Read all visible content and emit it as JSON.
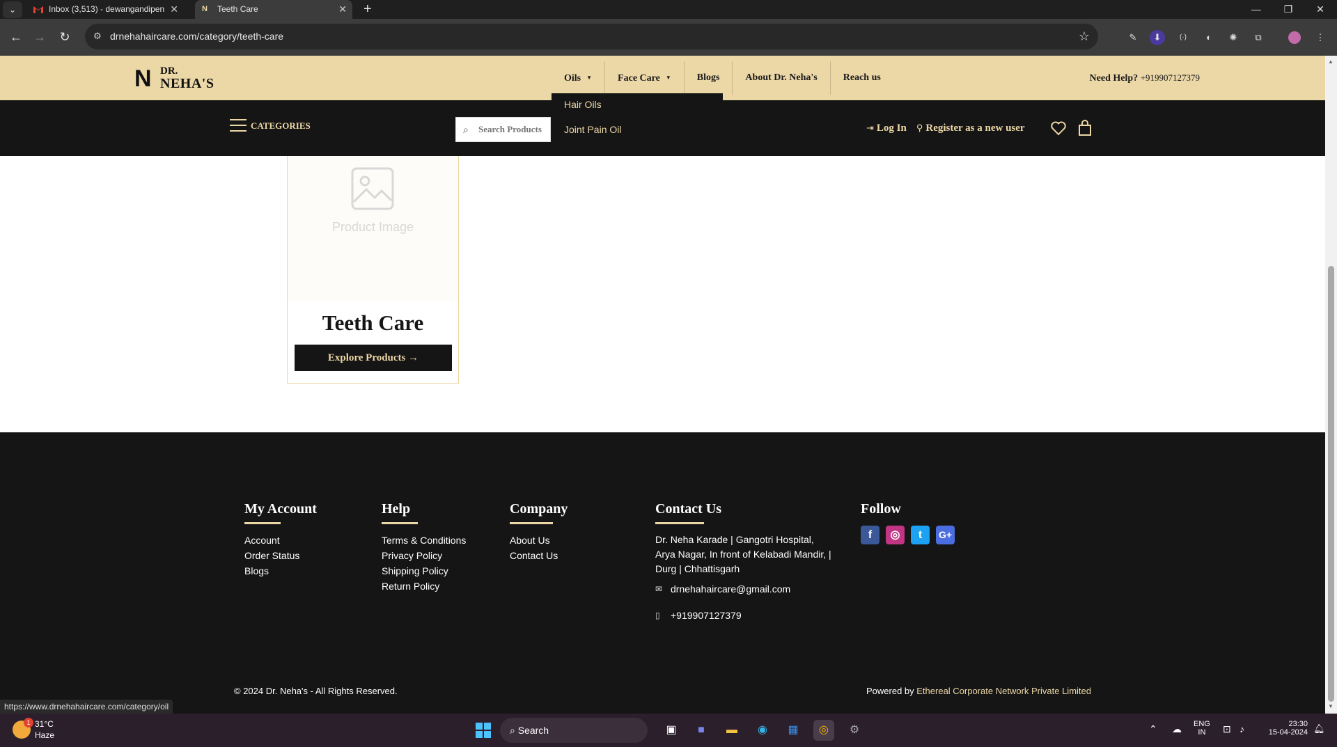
{
  "browser": {
    "tabs": [
      {
        "label": "Inbox (3,513) - dewangandipen",
        "active": false
      },
      {
        "label": "Teeth Care",
        "active": true
      }
    ],
    "url": "drnehahaircare.com/category/teeth-care",
    "status_url": "https://www.drnehahaircare.com/category/oil"
  },
  "site": {
    "logo": {
      "top": "DR.",
      "bottom": "NEHA'S"
    },
    "menu": [
      {
        "label": "Oils",
        "has_caret": true
      },
      {
        "label": "Face Care",
        "has_caret": true
      },
      {
        "label": "Blogs"
      },
      {
        "label": "About Dr. Neha's"
      },
      {
        "label": "Reach us"
      }
    ],
    "help": {
      "label": "Need Help?",
      "phone": "+919907127379"
    },
    "categories_label": "CATEGORIES",
    "search_placeholder": "Search Products",
    "oils_dropdown": [
      "Hair Oils",
      "Joint Pain Oil"
    ],
    "account": {
      "login": "Log In",
      "register": "Register as a new user"
    }
  },
  "card": {
    "placeholder": "Product Image",
    "title": "Teeth Care",
    "button": "Explore Products"
  },
  "footer": {
    "my_account": {
      "heading": "My Account",
      "links": [
        "Account",
        "Order Status",
        "Blogs"
      ]
    },
    "help": {
      "heading": "Help",
      "links": [
        "Terms & Conditions",
        "Privacy Policy",
        "Shipping Policy",
        "Return Policy"
      ]
    },
    "company": {
      "heading": "Company",
      "links": [
        "About Us",
        "Contact Us"
      ]
    },
    "contact": {
      "heading": "Contact Us",
      "address_lines": [
        "Dr. Neha Karade | Gangotri Hospital,",
        "Arya Nagar, In front of Kelabadi Mandir, |",
        "Durg | Chhattisgarh"
      ],
      "email": "drnehahaircare@gmail.com",
      "phone": "+919907127379"
    },
    "follow": {
      "heading": "Follow",
      "icons": [
        "facebook-icon",
        "instagram-icon",
        "twitter-icon",
        "google-plus-icon"
      ]
    },
    "copyright": "© 2024 Dr. Neha's - All Rights Reserved.",
    "powered_prefix": "Powered by",
    "powered_company": "Ethereal Corporate Network Private Limited"
  },
  "taskbar": {
    "weather_temp": "31°C",
    "weather_desc": "Haze",
    "weather_badge": "1",
    "search": "Search",
    "lang_top": "ENG",
    "lang_bottom": "IN",
    "time": "23:30",
    "date": "15-04-2024"
  },
  "colors": {
    "accent": "#ecd7a6",
    "dark": "#151515"
  }
}
